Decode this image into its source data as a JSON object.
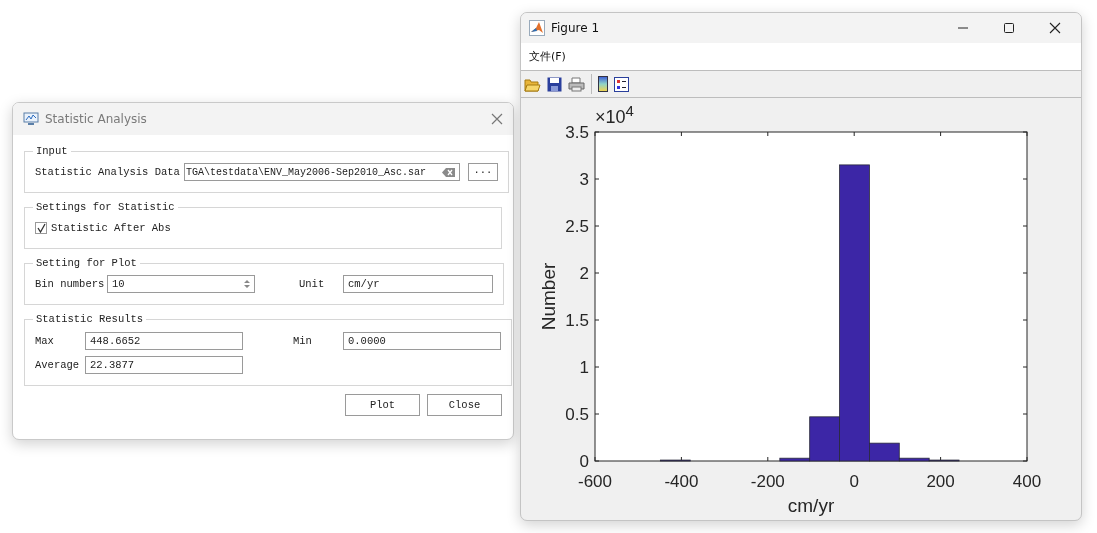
{
  "statistic_dialog": {
    "title": "Statistic Analysis",
    "input": {
      "legend": "Input",
      "label": "Statistic Analysis Data",
      "value": "TGA\\testdata\\ENV_May2006-Sep2010_Asc.sar",
      "browse": "···"
    },
    "settings": {
      "legend": "Settings for Statistic",
      "checkbox": {
        "label": "Statistic After Abs",
        "checked": true
      }
    },
    "plot_settings": {
      "legend": "Setting for Plot",
      "bin_label": "Bin numbers",
      "bin_value": "10",
      "unit_label": "Unit",
      "unit_value": "cm/yr"
    },
    "results": {
      "legend": "Statistic Results",
      "max_label": "Max",
      "max_value": "448.6652",
      "min_label": "Min",
      "min_value": "0.0000",
      "average_label": "Average",
      "average_value": "22.3877"
    },
    "buttons": [
      "Plot",
      "Close"
    ]
  },
  "figure_window": {
    "title": "Figure 1",
    "menu": [
      "文件(F)"
    ],
    "chart_data": {
      "type": "bar",
      "xlabel": "cm/yr",
      "ylabel": "Number",
      "x": [
        -414.1,
        -345.0,
        -275.8,
        -206.7,
        -137.6,
        -68.5,
        0.7,
        69.8,
        139.0,
        208.1
      ],
      "series": [
        {
          "color": "#3c26a6",
          "values": [
            0.01,
            0,
            0,
            0,
            0.03,
            0.47,
            3.15,
            0.19,
            0.03,
            0.01
          ]
        }
      ],
      "xlim": [
        -600,
        400
      ],
      "ylim": [
        0,
        3.5
      ],
      "xticks": [
        -600,
        -400,
        -200,
        0,
        200,
        400
      ],
      "yticks": [
        0,
        0.5,
        1,
        1.5,
        2,
        2.5,
        3,
        3.5
      ],
      "annotations": [
        {
          "text": "×10$^{4}$"
        }
      ]
    }
  }
}
